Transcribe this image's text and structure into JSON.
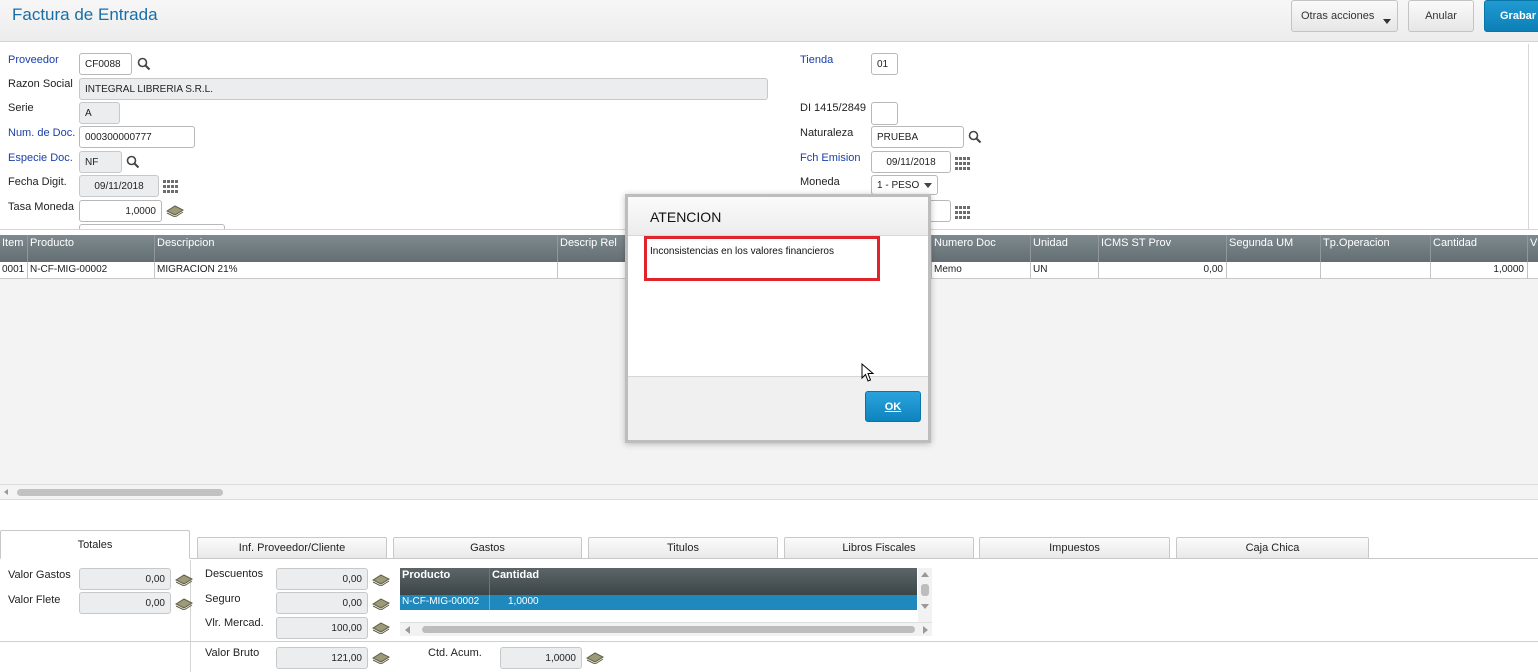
{
  "app": {
    "title": "Factura de Entrada"
  },
  "toolbar": {
    "otras_acciones": "Otras acciones",
    "anular": "Anular",
    "grabar": "Grabar"
  },
  "form": {
    "proveedor": {
      "label": "Proveedor",
      "value": "CF0088"
    },
    "razon_social": {
      "label": "Razon Social",
      "value": "INTEGRAL LIBRERIA S.R.L."
    },
    "serie": {
      "label": "Serie",
      "value": "A"
    },
    "num_doc": {
      "label": "Num. de Doc.",
      "value": "000300000777"
    },
    "especie_doc": {
      "label": "Especie Doc.",
      "value": "NF"
    },
    "fecha_digit": {
      "label": "Fecha Digit.",
      "value": "09/11/2018"
    },
    "tasa_moneda": {
      "label": "Tasa Moneda",
      "value": "1,0000"
    },
    "tienda": {
      "label": "Tienda",
      "value": "01"
    },
    "dl": {
      "label": "DI 1415/2849",
      "value": ""
    },
    "naturaleza": {
      "label": "Naturaleza",
      "value": "PRUEBA"
    },
    "fch_emision": {
      "label": "Fch Emision",
      "value": "09/11/2018"
    },
    "moneda": {
      "label": "Moneda",
      "value": "1 - PESO"
    }
  },
  "grid": {
    "headers": [
      "Item",
      "Producto",
      "Descripcion",
      "Descrip Rel",
      "Numero Doc",
      "Unidad",
      "ICMS ST Prov",
      "Segunda UM",
      "Tp.Operacion",
      "Cantidad",
      "V"
    ],
    "row": {
      "item": "0001",
      "producto": "N-CF-MIG-00002",
      "descripcion": "MIGRACION 21%",
      "numero_doc": "Memo",
      "unidad": "UN",
      "icms_st_prov": "0,00",
      "cantidad": "1,0000"
    }
  },
  "tabs": [
    "Totales",
    "Inf. Proveedor/Cliente",
    "Gastos",
    "Titulos",
    "Libros Fiscales",
    "Impuestos",
    "Caja Chica"
  ],
  "totals": {
    "valor_gastos": {
      "label": "Valor Gastos",
      "value": "0,00"
    },
    "valor_flete": {
      "label": "Valor Flete",
      "value": "0,00"
    },
    "descuentos": {
      "label": "Descuentos",
      "value": "0,00"
    },
    "seguro": {
      "label": "Seguro",
      "value": "0,00"
    },
    "vlr_mercad": {
      "label": "Vlr. Mercad.",
      "value": "100,00"
    },
    "valor_bruto": {
      "label": "Valor Bruto",
      "value": "121,00"
    },
    "ctd_acum": {
      "label": "Ctd. Acum.",
      "value": "1,0000"
    }
  },
  "mini_grid": {
    "headers": [
      "Producto",
      "Cantidad"
    ],
    "row": {
      "producto": "N-CF-MIG-00002",
      "cantidad": "1,0000"
    }
  },
  "modal": {
    "title": "ATENCION",
    "message": "Inconsistencias en los valores financieros",
    "ok_label": "OK"
  },
  "colors": {
    "accent": "#0e84bf",
    "title": "#1a6ea8",
    "highlight_border": "#e0242b",
    "grid_header": "#6b767b"
  }
}
